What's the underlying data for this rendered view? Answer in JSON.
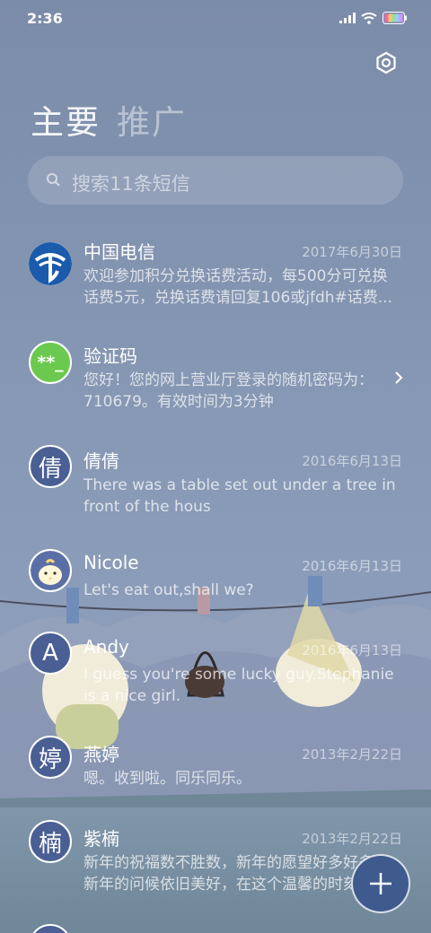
{
  "status": {
    "time": "2:36"
  },
  "tabs": [
    {
      "label": "主要"
    },
    {
      "label": "推广"
    }
  ],
  "search": {
    "placeholder": "搜索11条短信"
  },
  "messages": [
    {
      "name": "中国电信",
      "date": "2017年6月30日",
      "preview_line1": "欢迎参加积分兑换话费活动，每500分可兑换",
      "preview_line2": "话费5元，兑换话费请回复106或jfdh#话费..."
    },
    {
      "name": "验证码",
      "date": "",
      "avatar_text": "**_",
      "preview_line1": "您好！您的网上营业厅登录的随机密码为：",
      "preview_line2": "710679。有效时间为3分钟"
    },
    {
      "name": "倩倩",
      "date": "2016年6月13日",
      "avatar_text": "倩",
      "preview_line1": "There was a table set out under a tree in",
      "preview_line2": "front of the hous"
    },
    {
      "name": "Nicole",
      "date": "2016年6月13日",
      "preview_line1": "Let's eat out,shall we?",
      "preview_line2": ""
    },
    {
      "name": "Andy",
      "date": "2016年6月13日",
      "avatar_text": "A",
      "preview_line1": "I guess you're some lucky guy.Stephanie",
      "preview_line2": "is a nice girl."
    },
    {
      "name": "燕婷",
      "date": "2013年2月22日",
      "avatar_text": "婷",
      "preview_line1": "嗯。收到啦。同乐同乐。",
      "preview_line2": ""
    },
    {
      "name": "紫楠",
      "date": "2013年2月22日",
      "avatar_text": "楠",
      "preview_line1": "新年的祝福数不胜数，新年的愿望好多好多，",
      "preview_line2": "新年的问候依旧美好，在这个温馨的时刻..."
    }
  ],
  "colors": {
    "accent": "#3f5a8d",
    "avatar_bg": "#4a5f93",
    "otp_avatar": "#6cc94f",
    "telecom_blue": "#1a5bab"
  }
}
